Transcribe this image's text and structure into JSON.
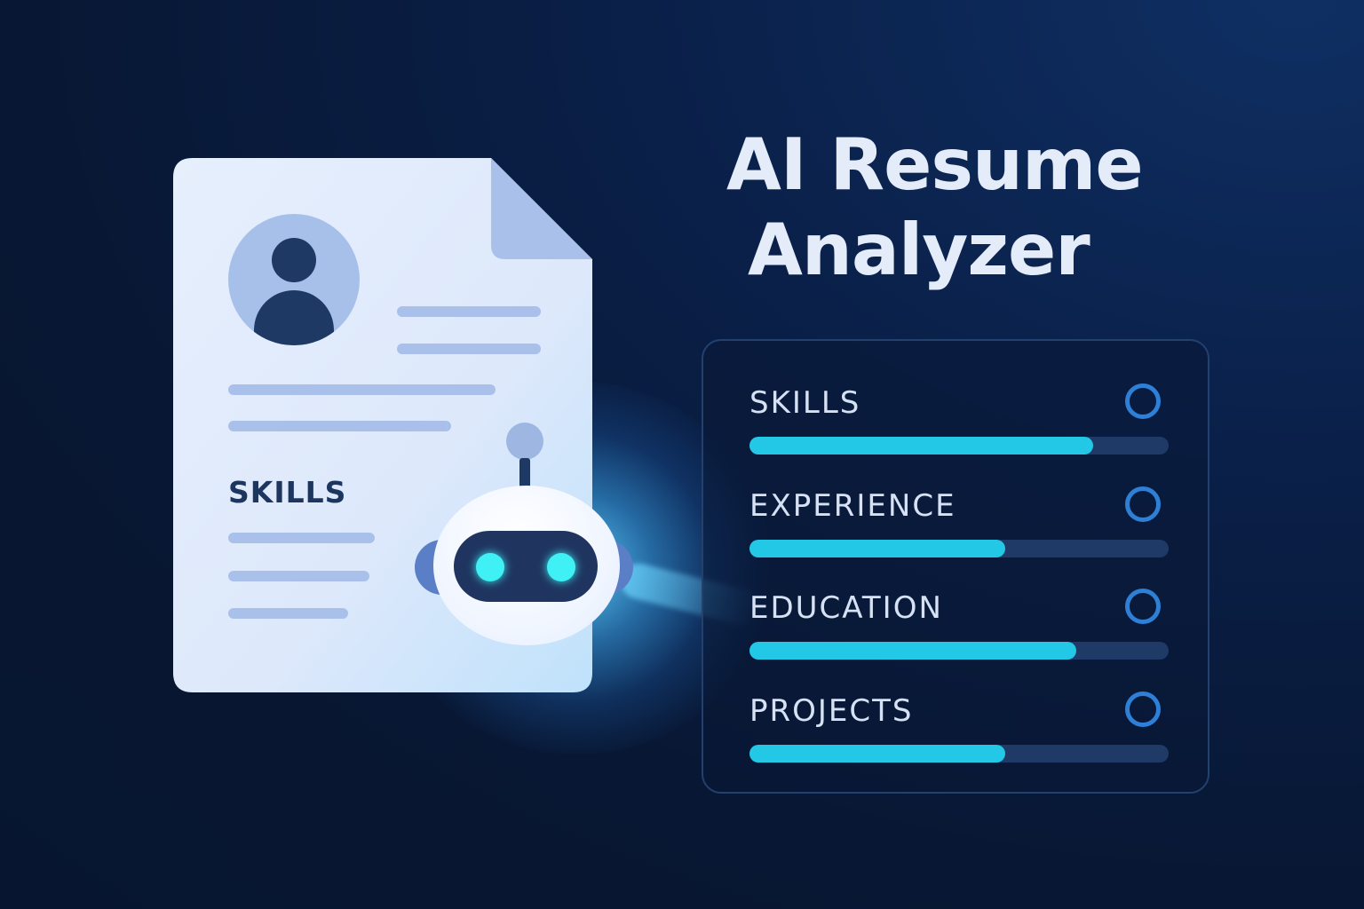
{
  "title": {
    "line1": "AI Resume",
    "line2": "Analyzer"
  },
  "resume_document": {
    "section_label": "SKILLS"
  },
  "analysis_panel": {
    "metrics": [
      {
        "label": "SKILLS",
        "score_fraction": 0.82
      },
      {
        "label": "EXPERIENCE",
        "score_fraction": 0.61
      },
      {
        "label": "EDUCATION",
        "score_fraction": 0.78
      },
      {
        "label": "PROJECTS",
        "score_fraction": 0.61
      }
    ]
  },
  "colors": {
    "background": "#081733",
    "document": "#e3ecfb",
    "bar_fill": "#22c8e5",
    "bar_track": "#1f3a66",
    "check_ring": "#2e7fd6",
    "robot_eye": "#3ff0f5"
  }
}
